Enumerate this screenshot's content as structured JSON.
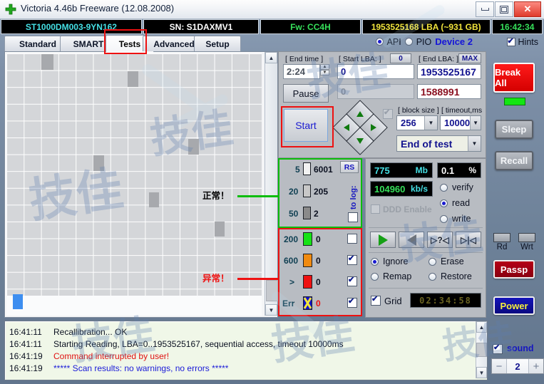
{
  "window": {
    "title": "Victoria 4.46b Freeware (12.08.2008)",
    "icon": "cross-icon",
    "minimize": "minimize-icon",
    "maximize": "maximize-icon",
    "close": "✕"
  },
  "driveinfo": {
    "model": "ST1000DM003-9YN162",
    "serial": "SN: S1DAXMV1",
    "firmware": "Fw: CC4H",
    "capacity": "1953525168 LBA (~931 GB)",
    "clock": "16:42:34",
    "colors": {
      "model": "#45e0e5",
      "serial": "#ffffff",
      "firmware": "#36e05a",
      "capacity": "#f2e53c",
      "clock": "#36e05a"
    }
  },
  "tabs": [
    {
      "label": "Standard",
      "active": false
    },
    {
      "label": "SMART",
      "active": false
    },
    {
      "label": "Tests",
      "active": true
    },
    {
      "label": "Advanced",
      "active": false
    },
    {
      "label": "Setup",
      "active": false
    }
  ],
  "mode": {
    "api_label": "API",
    "api_selected": true,
    "pio_label": "PIO",
    "pio_selected": false,
    "device_label": "Device 2",
    "hints_label": "Hints",
    "hints_checked": true
  },
  "scan": {
    "end_time_label": "[ End time ]",
    "end_time_value": "2:24",
    "start_lba_label": "[ Start LBA: ]",
    "start_lba_reset": "0",
    "start_lba_value": "0",
    "end_lba_label": "[ End LBA: ]",
    "end_lba_max": "MAX",
    "end_lba_value": "1953525167",
    "current_lba_value": "0",
    "current_position_value": "1588991",
    "pause_label": "Pause",
    "start_label": "Start",
    "block_size_label": "[ block size ]",
    "block_size_value": "256",
    "timeout_label": "[ timeout,ms ]",
    "timeout_value": "10000",
    "end_action_value": "End of test"
  },
  "timing_good": {
    "rs_label": "RS",
    "to_log_label": "to log:",
    "rows": [
      {
        "threshold": "5",
        "count": "6001",
        "color": "#f2f2f2"
      },
      {
        "threshold": "20",
        "count": "205",
        "color": "#c8c8c8"
      },
      {
        "threshold": "50",
        "count": "2",
        "color": "#8a8a8a"
      }
    ],
    "log_checkbox": false
  },
  "timing_bad": {
    "rows": [
      {
        "threshold": "200",
        "count": "0",
        "color": "#16e216",
        "checked": false
      },
      {
        "threshold": "600",
        "count": "0",
        "color": "#f08a10",
        "checked": true
      },
      {
        "threshold": ">",
        "count": "0",
        "color": "#ee1111",
        "checked": true
      },
      {
        "threshold": "Err",
        "count": "0",
        "color": "#1111cc",
        "checked": true
      }
    ]
  },
  "stats": {
    "size_value": "775",
    "size_unit": "Mb",
    "percent_value": "0.1",
    "percent_unit": "%",
    "speed_value": "104960",
    "speed_unit": "kb/s",
    "ddd_label": "DDD Enable",
    "ddd_checked": false
  },
  "operation": {
    "options": [
      {
        "label": "verify",
        "selected": false
      },
      {
        "label": "read",
        "selected": true
      },
      {
        "label": "write",
        "selected": false
      }
    ]
  },
  "transport": [
    {
      "name": "play-forward-button",
      "glyph": "▶"
    },
    {
      "name": "play-backward-button",
      "glyph": "◀"
    },
    {
      "name": "random-seek-button",
      "glyph": "▷?◁"
    },
    {
      "name": "butterfly-seek-button",
      "glyph": "▷|◁"
    }
  ],
  "defect_action": [
    {
      "label": "Ignore",
      "selected": true
    },
    {
      "label": "Erase",
      "selected": false
    },
    {
      "label": "Remap",
      "selected": false
    },
    {
      "label": "Restore",
      "selected": false
    }
  ],
  "grid": {
    "label": "Grid",
    "checked": true,
    "display": "02:34:58"
  },
  "sidebuttons": {
    "break_all": "Break All",
    "sleep": "Sleep",
    "recall": "Recall",
    "rd_label": "Rd",
    "wrt_label": "Wrt",
    "passp": "Passp",
    "power": "Power"
  },
  "log": {
    "entries": [
      {
        "time": "16:41:11",
        "text": "Recallibration... OK",
        "color": "#0a1020"
      },
      {
        "time": "16:41:11",
        "text": "Starting Reading, LBA=0..1953525167, sequential access, timeout 10000ms",
        "color": "#0a1020"
      },
      {
        "time": "16:41:19",
        "text": "Command interrupted by user!",
        "color": "#e01010"
      },
      {
        "time": "16:41:19",
        "text": "***** Scan results: no warnings, no errors *****",
        "color": "#1a1ad8"
      }
    ]
  },
  "sound": {
    "label": "sound",
    "checked": true,
    "minus": "−",
    "value": "2",
    "plus": "+"
  },
  "annotations": [
    {
      "text": "正常！",
      "color": "#000000",
      "line_color": "#0bbd0b"
    },
    {
      "text": "异常！",
      "color": "#ee1111",
      "line_color": "#ee1111"
    }
  ]
}
